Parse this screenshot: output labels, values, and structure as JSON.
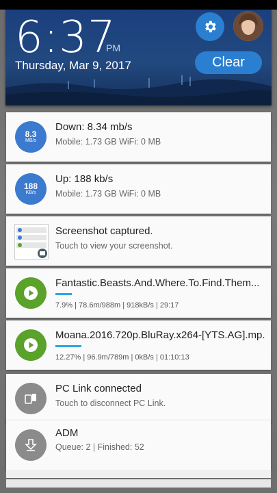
{
  "status": {
    "time": "6:37",
    "ampm": "PM",
    "date": "Thursday, Mar 9, 2017",
    "clear_label": "Clear"
  },
  "notifications": {
    "down": {
      "icon_value": "8.3",
      "icon_unit": "MB/s",
      "title": "Down: 8.34 mb/s",
      "subtitle": "Mobile: 1.73 GB   WiFi: 0 MB"
    },
    "up": {
      "icon_value": "188",
      "icon_unit": "KB/s",
      "title": "Up: 188 kb/s",
      "subtitle": "Mobile: 1.73 GB   WiFi: 0 MB"
    },
    "screenshot": {
      "title": "Screenshot captured.",
      "subtitle": "Touch to view your screenshot."
    },
    "download1": {
      "title": "Fantastic.Beasts.And.Where.To.Find.Them...",
      "progress": 0.079,
      "stats": "7.9%  |  78.6m/988m  |  918kB/s  |  29:17"
    },
    "download2": {
      "title": "Moana.2016.720p.BluRay.x264-[YTS.AG].mp...",
      "progress": 0.1227,
      "stats": "12.27%  |  96.9m/789m  |  0kB/s  |  01:10:13"
    },
    "pclink": {
      "title": "PC Link connected",
      "subtitle": "Touch to disconnect PC Link."
    },
    "adm": {
      "title": "ADM",
      "subtitle": "Queue: 2  |  Finished: 52"
    }
  },
  "colors": {
    "header": "#1b3f7e",
    "accent": "#2b7fd0",
    "green": "#5aa22a",
    "blue": "#3c7ad0",
    "progress": "#2aa8e0"
  },
  "icons": [
    "settings-gear-icon",
    "user-avatar",
    "play-icon",
    "pc-link-icon",
    "download-icon"
  ]
}
